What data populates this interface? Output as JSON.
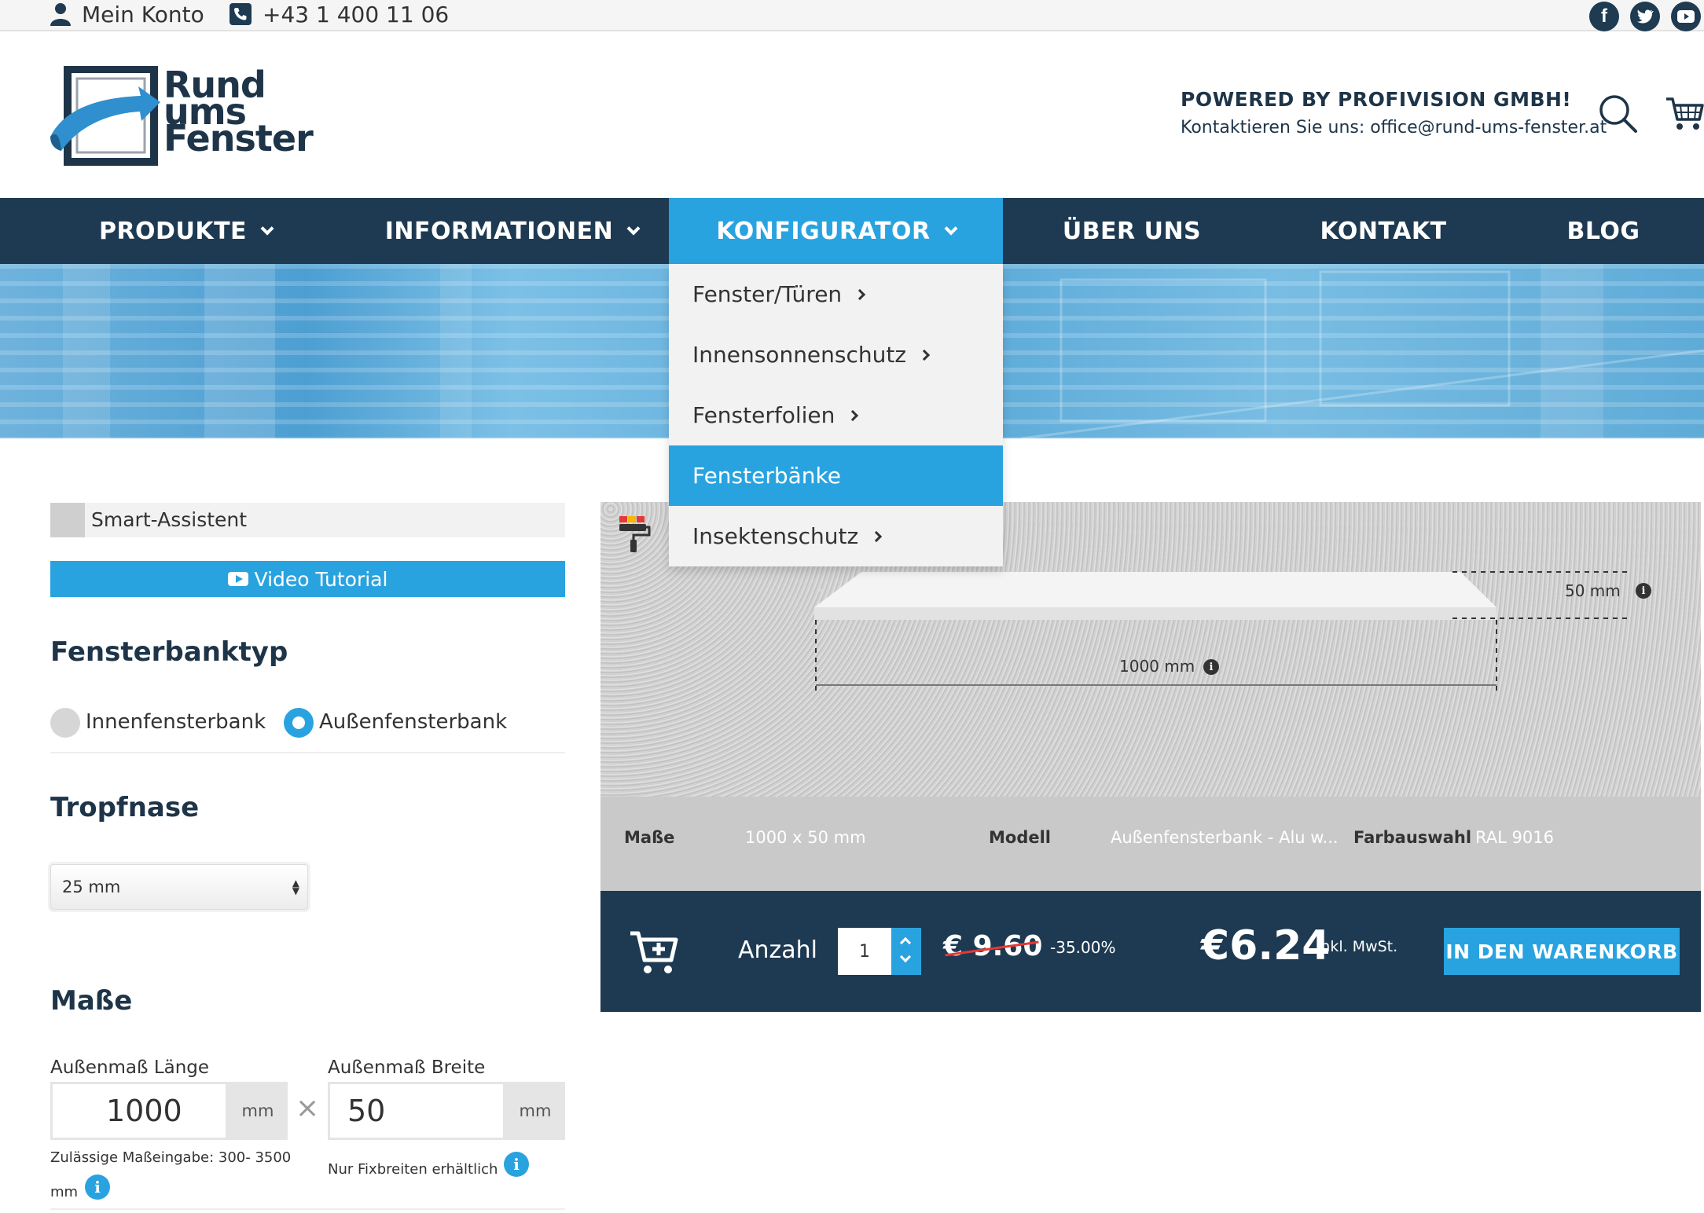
{
  "topbar": {
    "account_label": "Mein Konto",
    "phone": "+43 1 400 11 06",
    "social": [
      "facebook-icon",
      "twitter-icon",
      "youtube-icon"
    ]
  },
  "header": {
    "logo_lines": [
      "Rund",
      "ums",
      "Fenster"
    ],
    "powered_by": "POWERED BY PROFIVISION GMBH!",
    "contact": "Kontaktieren Sie uns: office@rund-ums-fenster.at"
  },
  "nav": {
    "items": [
      {
        "label": "PRODUKTE",
        "dropdown": true
      },
      {
        "label": "INFORMATIONEN",
        "dropdown": true
      },
      {
        "label": "KONFIGURATOR",
        "dropdown": true,
        "active": true
      },
      {
        "label": "ÜBER UNS",
        "dropdown": false
      },
      {
        "label": "KONTAKT",
        "dropdown": false
      },
      {
        "label": "BLOG",
        "dropdown": false
      }
    ]
  },
  "dropdown": {
    "items": [
      {
        "label": "Fenster/Türen",
        "submenu": true
      },
      {
        "label": "Innensonnenschutz",
        "submenu": true
      },
      {
        "label": "Fensterfolien",
        "submenu": true
      },
      {
        "label": "Fensterbänke",
        "submenu": false,
        "active": true
      },
      {
        "label": "Insektenschutz",
        "submenu": true
      }
    ]
  },
  "left": {
    "smart_assistant": "Smart-Assistent",
    "video_tutorial": "Video Tutorial",
    "type_heading": "Fensterbanktyp",
    "type_options": [
      {
        "label": "Innenfensterbank",
        "selected": false
      },
      {
        "label": "Außenfensterbank",
        "selected": true
      }
    ],
    "drip_heading": "Tropfnase",
    "drip_value": "25 mm",
    "dims_heading": "Maße",
    "length_label": "Außenmaß Länge",
    "length_value": "1000",
    "width_label": "Außenmaß Breite",
    "width_value": "50",
    "unit": "mm",
    "times": "×",
    "length_hint": "Zulässige Maßeingabe: 300- 3500",
    "length_hint_unit": "mm",
    "width_hint": "Nur Fixbreiten erhältlich"
  },
  "preview": {
    "depth_label": "50 mm",
    "length_label": "1000 mm"
  },
  "specs": {
    "dims_key": "Maße",
    "dims_value": "1000 x 50 mm",
    "model_key": "Modell",
    "model_value": "Außenfensterbank - Alu w...",
    "color_key": "Farbauswahl",
    "color_value": "RAL 9016"
  },
  "buy": {
    "qty_label": "Anzahl",
    "qty_value": "1",
    "old_price": "€ 9.60",
    "discount": "-35.00%",
    "price": "€6.24",
    "vat": "inkl. MwSt.",
    "add_to_cart": "IN DEN WARENKORB"
  },
  "colors": {
    "navy": "#1d3a52",
    "accent": "#29a3e0",
    "strike": "#e53935"
  }
}
